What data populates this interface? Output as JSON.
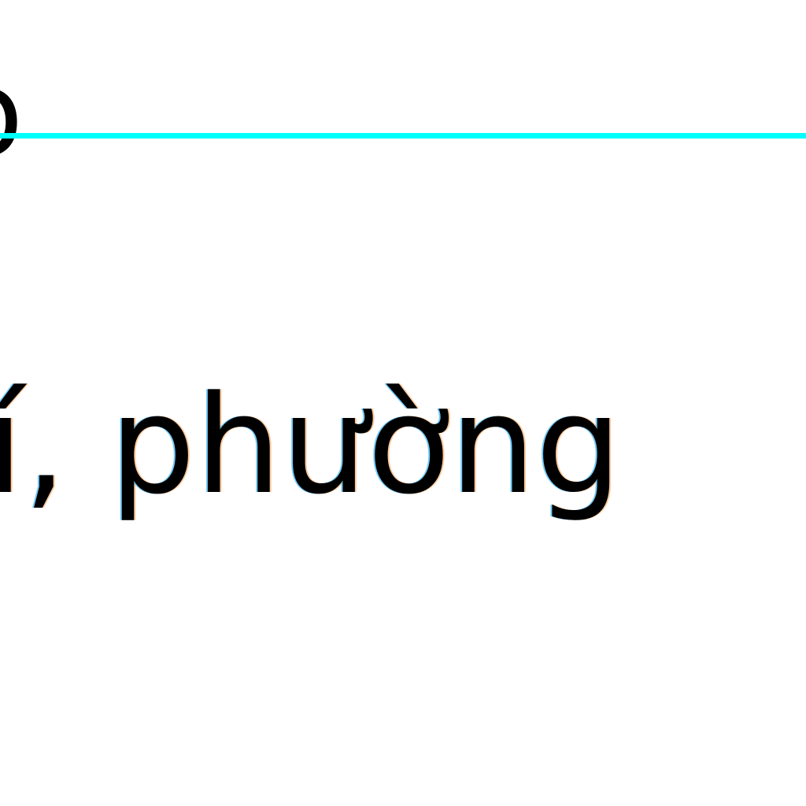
{
  "top_fragment": "o",
  "text_fragment": "í, phường",
  "colors": {
    "background": "#ffffff",
    "text": "#000000",
    "guide_line": "#00ffff"
  }
}
